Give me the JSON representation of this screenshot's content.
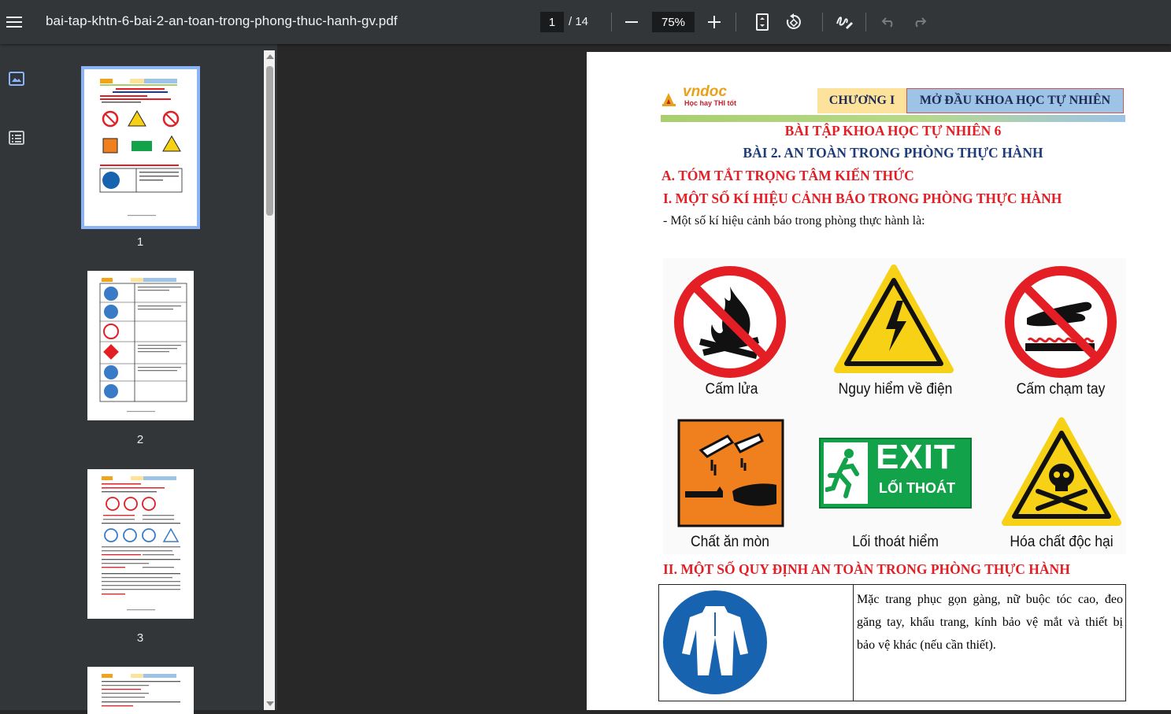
{
  "toolbar": {
    "filename": "bai-tap-khtn-6-bai-2-an-toan-trong-phong-thuc-hanh-gv.pdf",
    "current_page": "1",
    "total_pages": "/ 14",
    "zoom": "75%"
  },
  "sidebar": {
    "thumbnails": [
      {
        "label": "1"
      },
      {
        "label": "2"
      },
      {
        "label": "3"
      },
      {
        "label": ""
      }
    ]
  },
  "document": {
    "logo": {
      "brand": "vndoc",
      "tagline": "Học hay THI tốt"
    },
    "chapter": "CHƯƠNG I",
    "chapter_title": "MỞ ĐẦU KHOA HỌC TỰ NHIÊN",
    "heading1": "BÀI TẬP KHOA HỌC TỰ NHIÊN 6",
    "heading2": "BÀI 2. AN TOÀN TRONG PHÒNG THỰC HÀNH",
    "section_a": "A. TÓM TẮT TRỌNG TÂM KIẾN THỨC",
    "section_i": "I. MỘT SỐ KÍ HIỆU CẢNH BÁO TRONG PHÒNG THỰC HÀNH",
    "intro": "- Một số kí hiệu cảnh báo trong phòng thực hành là:",
    "signs": [
      {
        "label": "Cấm lửa",
        "icon": "no-fire-icon"
      },
      {
        "label": "Nguy hiểm về điện",
        "icon": "electric-hazard-icon"
      },
      {
        "label": "Cấm chạm tay",
        "icon": "no-touch-icon"
      },
      {
        "label": "Chất ăn mòn",
        "icon": "corrosive-icon"
      },
      {
        "label": "Lối thoát hiểm",
        "icon": "exit-sign-icon"
      },
      {
        "label": "Hóa chất độc hại",
        "icon": "toxic-icon"
      }
    ],
    "exit_sign": {
      "big": "EXIT",
      "small": "LỐI THOÁT"
    },
    "section_ii": "II. MỘT SỐ QUY ĐỊNH AN TOÀN TRONG PHÒNG THỰC HÀNH",
    "rule1": {
      "icon": "protective-suit-icon",
      "lines": [
        "Mặc trang phục gọn gàng, nữ buộc tóc cao, đeo",
        "găng tay, khẩu trang, kính bảo vệ mắt và thiết bị",
        "bảo vệ khác (nếu cần thiết)."
      ]
    }
  },
  "colors": {
    "toolbar": "#323639",
    "background": "#282828",
    "selected": "#8ab4f8",
    "red_heading": "#e31e24",
    "navy_heading": "#1f3c7a"
  }
}
